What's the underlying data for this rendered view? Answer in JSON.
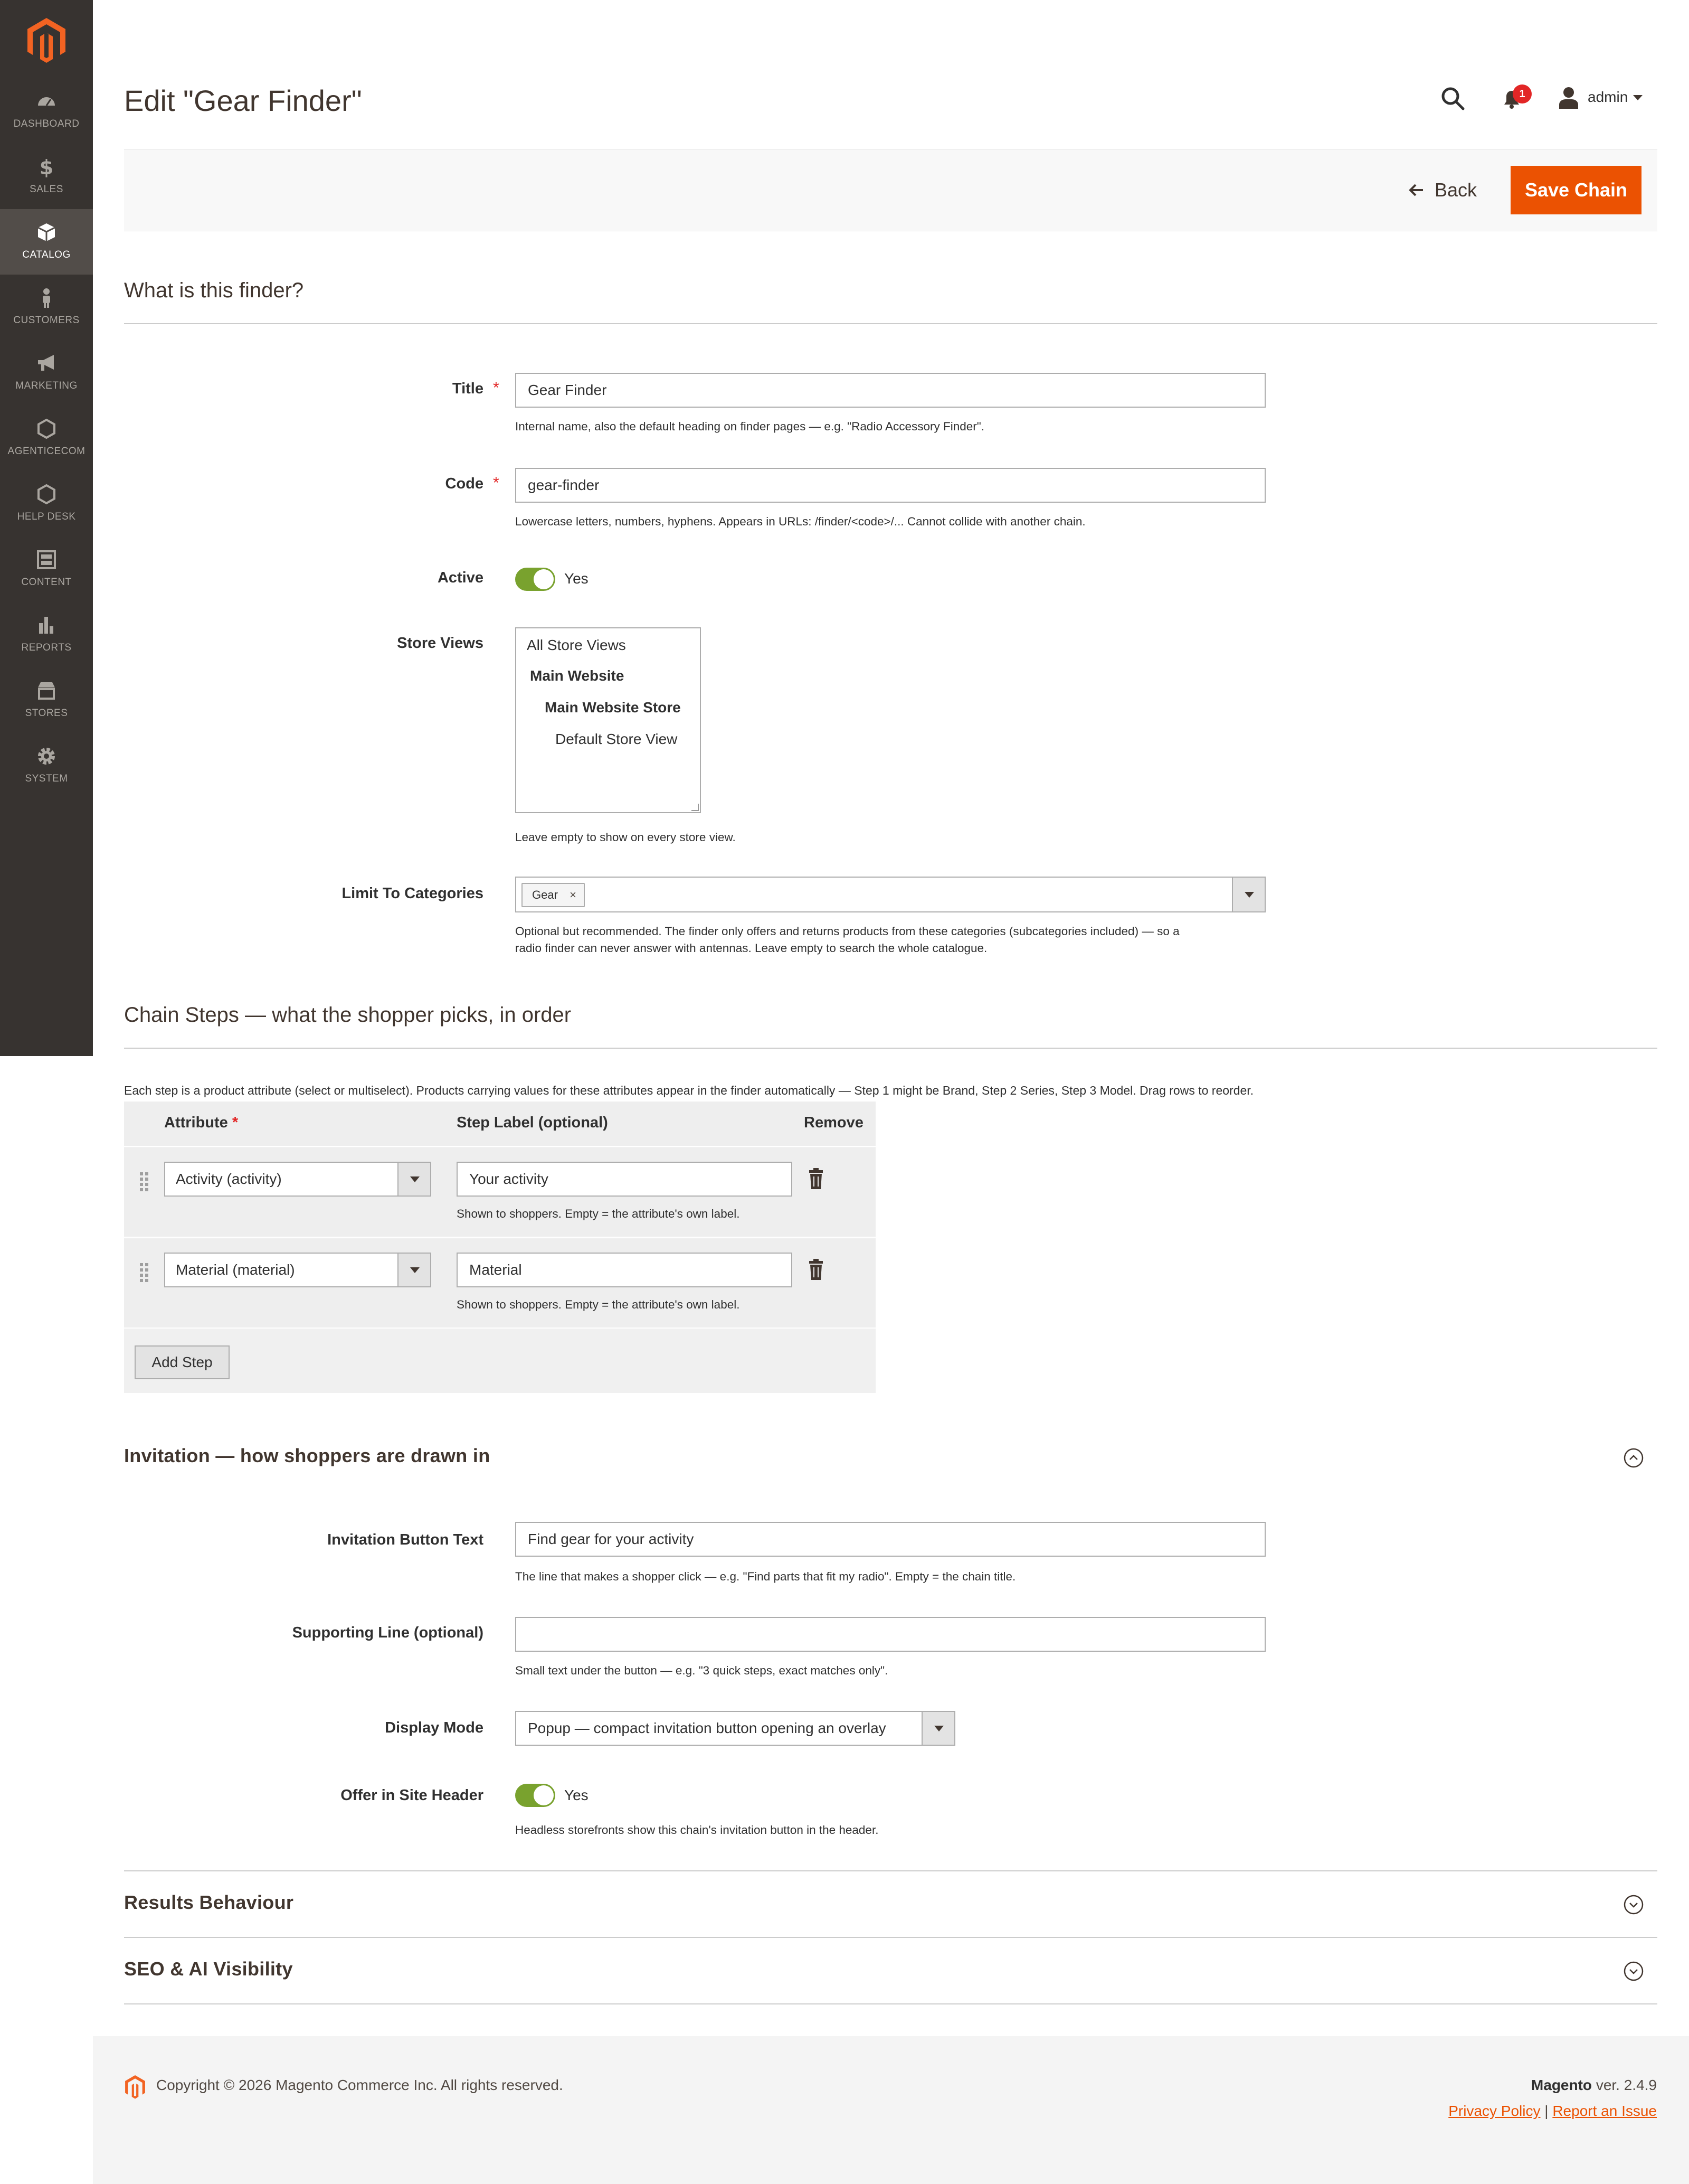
{
  "sidebar": {
    "items": [
      {
        "label": "Dashboard",
        "icon": "dashboard-icon"
      },
      {
        "label": "Sales",
        "icon": "dollar-icon"
      },
      {
        "label": "Catalog",
        "icon": "box-icon",
        "active": true
      },
      {
        "label": "Customers",
        "icon": "person-icon"
      },
      {
        "label": "Marketing",
        "icon": "megaphone-icon"
      },
      {
        "label": "Agenticecom",
        "icon": "hexagon-icon"
      },
      {
        "label": "Help Desk",
        "icon": "hexagon-icon"
      },
      {
        "label": "Content",
        "icon": "layout-icon"
      },
      {
        "label": "Reports",
        "icon": "bar-chart-icon"
      },
      {
        "label": "Stores",
        "icon": "store-icon"
      },
      {
        "label": "System",
        "icon": "gear-icon"
      }
    ]
  },
  "header": {
    "title": "Edit \"Gear Finder\"",
    "notifications_count": "1",
    "username": "admin"
  },
  "actions": {
    "back_label": "Back",
    "save_label": "Save Chain"
  },
  "finder": {
    "section_title": "What is this finder?",
    "title_label": "Title",
    "title_value": "Gear Finder",
    "title_note": "Internal name, also the default heading on finder pages — e.g. \"Radio Accessory Finder\".",
    "code_label": "Code",
    "code_value": "gear-finder",
    "code_note": "Lowercase letters, numbers, hyphens. Appears in URLs: /finder/<code>/... Cannot collide with another chain.",
    "active_label": "Active",
    "active_value": "Yes",
    "store_views_label": "Store Views",
    "store_views_options": [
      "All Store Views",
      "Main Website",
      "Main Website Store",
      "Default Store View"
    ],
    "store_views_note": "Leave empty to show on every store view.",
    "categories_label": "Limit To Categories",
    "categories_tag": "Gear",
    "categories_note_line1": "Optional but recommended. The finder only offers and returns products from these categories (subcategories included) — so a",
    "categories_note_line2": "radio finder can never answer with antennas. Leave empty to search the whole catalogue."
  },
  "steps": {
    "section_title": "Chain Steps — what the shopper picks, in order",
    "intro": "Each step is a product attribute (select or multiselect). Products carrying values for these attributes appear in the finder automatically — Step 1 might be Brand, Step 2 Series, Step 3 Model. Drag rows to reorder.",
    "columns": {
      "attribute": "Attribute",
      "label": "Step Label (optional)",
      "remove": "Remove"
    },
    "rows": [
      {
        "attribute": "Activity (activity)",
        "label": "Your activity",
        "note": "Shown to shoppers. Empty = the attribute's own label."
      },
      {
        "attribute": "Material (material)",
        "label": "Material",
        "note": "Shown to shoppers. Empty = the attribute's own label."
      }
    ],
    "add_label": "Add Step"
  },
  "invitation": {
    "section_title": "Invitation — how shoppers are drawn in",
    "button_text_label": "Invitation Button Text",
    "button_text_value": "Find gear for your activity",
    "button_text_note": "The line that makes a shopper click — e.g. \"Find parts that fit my radio\". Empty = the chain title.",
    "supporting_label": "Supporting Line (optional)",
    "supporting_value": "",
    "supporting_note": "Small text under the button — e.g. \"3 quick steps, exact matches only\".",
    "display_mode_label": "Display Mode",
    "display_mode_value": "Popup — compact invitation button opening an overlay",
    "header_label": "Offer in Site Header",
    "header_value": "Yes",
    "header_note": "Headless storefronts show this chain's invitation button in the header."
  },
  "collapsed": {
    "results_title": "Results Behaviour",
    "seo_title": "SEO & AI Visibility"
  },
  "footer": {
    "copyright": "Copyright © 2026 Magento Commerce Inc. All rights reserved.",
    "brand": "Magento",
    "version": "ver. 2.4.9",
    "privacy": "Privacy Policy",
    "separator": "|",
    "report": "Report an Issue"
  },
  "colors": {
    "accent": "#eb5202",
    "sidebar_bg": "#373330",
    "toggle_on": "#79a22e",
    "badge": "#e22626"
  }
}
